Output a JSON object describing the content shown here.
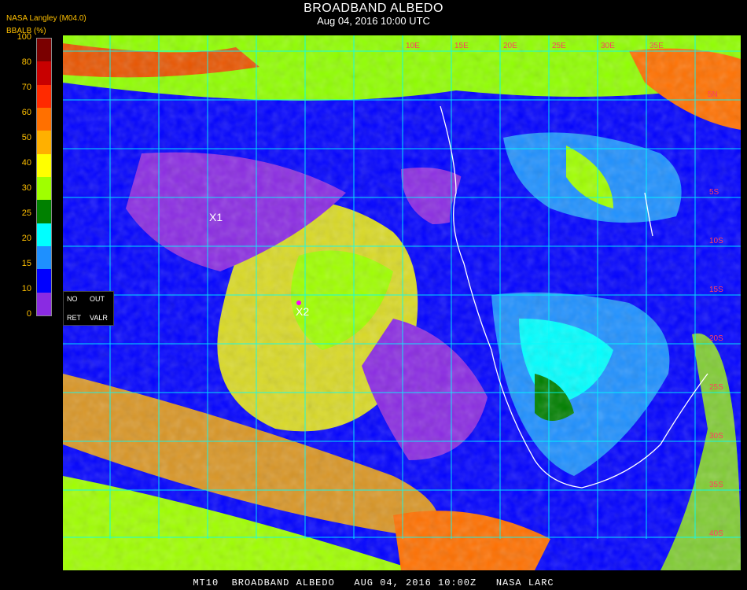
{
  "header": {
    "title": "BROADBAND ALBEDO",
    "datetime": "Aug 04, 2016 10:00 UTC",
    "agency": "NASA Langley (M04.0)"
  },
  "legend": {
    "title": "BBALB (%)",
    "ticks": [
      "100",
      "80",
      "70",
      "60",
      "50",
      "40",
      "30",
      "25",
      "20",
      "15",
      "10",
      "0"
    ],
    "colors": [
      "#7a0000",
      "#c80000",
      "#ff2a00",
      "#ff7000",
      "#ffb000",
      "#ffff00",
      "#a0ff00",
      "#008000",
      "#00ffff",
      "#1e90ff",
      "#0000ff",
      "#8a2be2"
    ]
  },
  "keybox": {
    "no": "NO",
    "out": "OUT",
    "ret": "RET",
    "valr": "VALR"
  },
  "markers": [
    {
      "label": "X1"
    },
    {
      "label": "X2"
    }
  ],
  "grid_labels": [
    "5N",
    "10E",
    "15E",
    "20E",
    "25E",
    "30E",
    "35E",
    "5S",
    "10S",
    "15S",
    "20S",
    "25S",
    "30S",
    "35S",
    "40S"
  ],
  "footer": "MT10  BROADBAND ALBEDO   AUG 04, 2016 10:00Z   NASA LARC"
}
